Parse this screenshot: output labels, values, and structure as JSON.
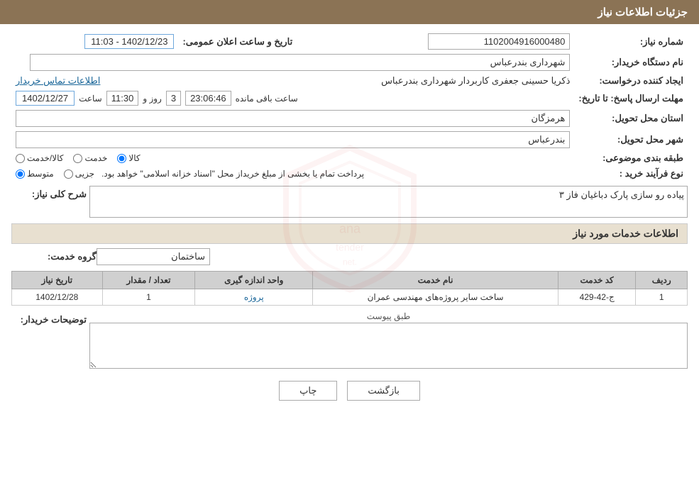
{
  "header": {
    "title": "جزئیات اطلاعات نیاز"
  },
  "fields": {
    "neeaz_number_label": "شماره نیاز:",
    "neeaz_number_value": "1102004916000480",
    "date_label": "تاریخ و ساعت اعلان عمومی:",
    "date_value": "1402/12/23 - 11:03",
    "buyer_name_label": "نام دستگاه خریدار:",
    "buyer_name_value": "شهرداری بندرعباس",
    "creator_label": "ایجاد کننده درخواست:",
    "creator_value": "ذکریا حسینی جعفری کاربردار شهرداری بندرعباس",
    "contact_link": "اطلاعات تماس خریدار",
    "deadline_label": "مهلت ارسال پاسخ: تا تاریخ:",
    "deadline_date": "1402/12/27",
    "deadline_time": "11:30",
    "deadline_days": "3",
    "deadline_remaining": "23:06:46",
    "deadline_remaining_label": "ساعت باقی مانده",
    "days_label": "روز و",
    "province_label": "استان محل تحویل:",
    "province_value": "هرمزگان",
    "city_label": "شهر محل تحویل:",
    "city_value": "بندرعباس",
    "category_label": "طبقه بندی موضوعی:",
    "category_options": [
      "کالا",
      "خدمت",
      "کالا/خدمت"
    ],
    "category_selected": "کالا",
    "process_label": "نوع فرآیند خرید :",
    "process_options": [
      "جزیی",
      "متوسط"
    ],
    "process_selected": "متوسط",
    "process_note": "پرداخت تمام یا بخشی از مبلغ خریداز محل \"اسناد خزانه اسلامی\" خواهد بود.",
    "description_label": "شرح کلی نیاز:",
    "description_value": "پیاده رو سازی پارک دباغیان فاز ۳",
    "services_label": "اطلاعات خدمات مورد نیاز",
    "service_group_label": "گروه خدمت:",
    "service_group_value": "ساختمان",
    "table": {
      "columns": [
        "ردیف",
        "کد خدمت",
        "نام خدمت",
        "واحد اندازه گیری",
        "تعداد / مقدار",
        "تاریخ نیاز"
      ],
      "rows": [
        {
          "row": "1",
          "code": "ج-42-429",
          "name": "ساخت سایر پروژه‌های مهندسی عمران",
          "unit": "پروژه",
          "qty": "1",
          "date": "1402/12/28"
        }
      ]
    },
    "attachment_label": "طبق پیوست",
    "buyer_desc_label": "توضیحات خریدار:",
    "buyer_desc_value": "",
    "buttons": {
      "print": "چاپ",
      "back": "بازگشت"
    }
  }
}
